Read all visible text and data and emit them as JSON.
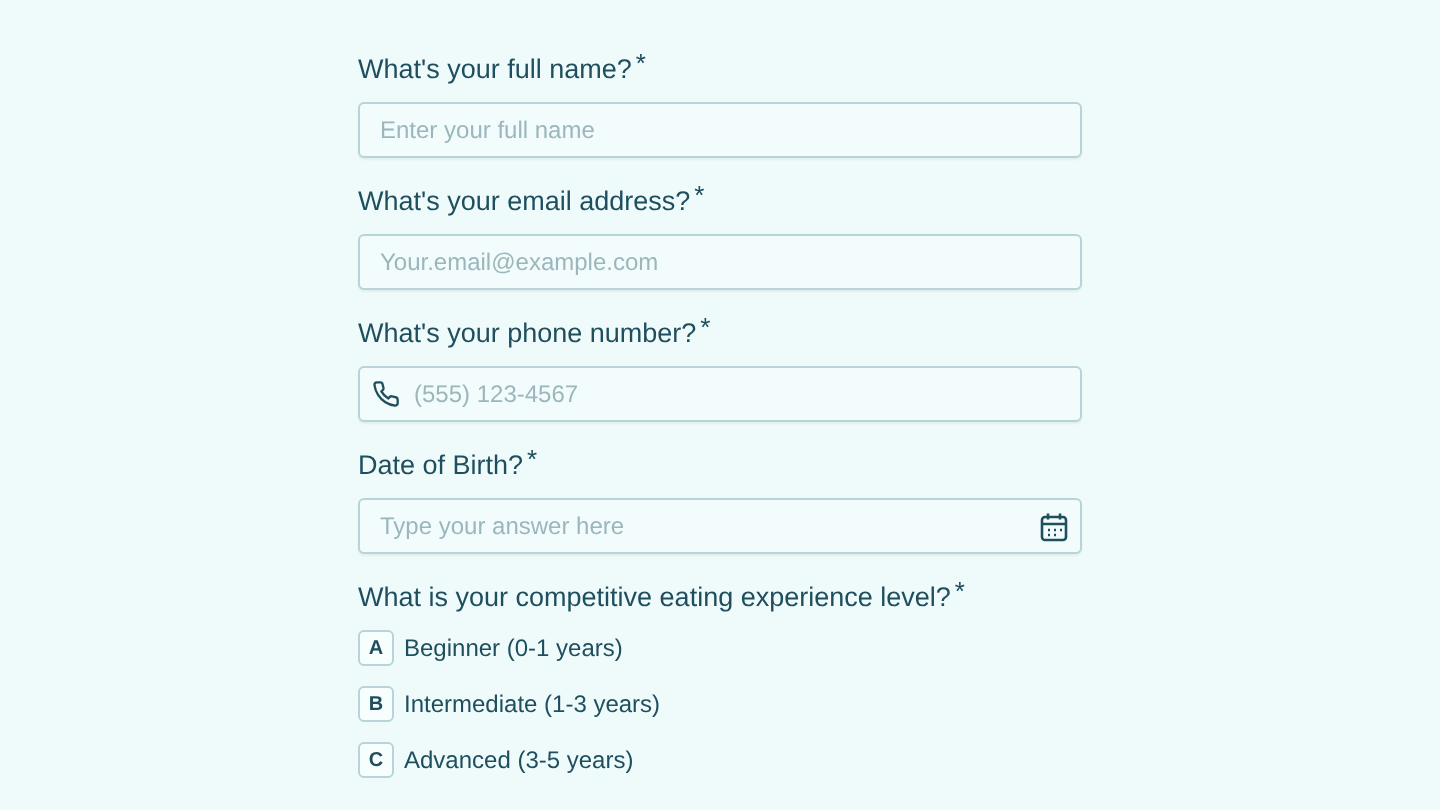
{
  "questions": [
    {
      "kind": "text",
      "label": "What's your full name?",
      "mark": "*",
      "placeholder": "Enter your full name"
    },
    {
      "kind": "text",
      "label": "What's your email address?",
      "mark": "*",
      "placeholder": "Your.email@example.com"
    },
    {
      "kind": "phone",
      "label": "What's your phone number?",
      "mark": "*",
      "placeholder": "(555) 123-4567"
    },
    {
      "kind": "date",
      "label": "Date of Birth?",
      "mark": "*",
      "placeholder": "Type your answer here"
    },
    {
      "kind": "choice",
      "label": "What is your competitive eating experience level?",
      "mark": "*",
      "options": [
        {
          "key": "A",
          "label": "Beginner (0-1 years)",
          "selected": false
        },
        {
          "key": "B",
          "label": "Intermediate (1-3 years)",
          "selected": false
        },
        {
          "key": "C",
          "label": "Advanced (3-5 years)",
          "selected": false
        }
      ]
    }
  ]
}
